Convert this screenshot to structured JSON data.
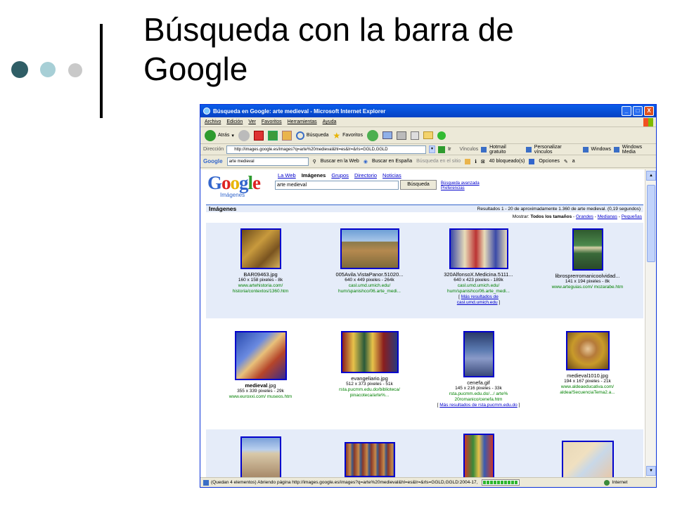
{
  "slide": {
    "title_line1": "Búsqueda con la barra de",
    "title_line2": "Google"
  },
  "colors": {
    "dot1": "#2f5e66",
    "dot2": "#a7cfd6",
    "dot3": "#c9c9c9",
    "accent": "#0000cc",
    "green": "#008000"
  },
  "window": {
    "title": "Búsqueda en Google: arte medieval - Microsoft Internet Explorer",
    "buttons": [
      "_",
      "□",
      "X"
    ]
  },
  "menu": [
    "Archivo",
    "Edición",
    "Ver",
    "Favoritos",
    "Herramientas",
    "Ayuda"
  ],
  "toolbar": {
    "back": "Atrás",
    "search": "Búsqueda",
    "favorites": "Favoritos"
  },
  "address": {
    "label": "Dirección",
    "url": "http://images.google.es/images?q=arte%20medieval&hl=es&lr=&rls=GGLD,GGLD",
    "go": "Ir",
    "links": "Vínculos",
    "hotmail": "Hotmail gratuito",
    "personalize": "Personalizar vínculos",
    "windows": "Windows",
    "windows_media": "Windows Media"
  },
  "google_toolbar": {
    "label": "Google",
    "query": "arte medieval",
    "search_web": "Buscar en la Web",
    "search_spain": "Buscar en España",
    "search_site": "Búsqueda en el sitio",
    "blocked": "40 bloqueado(s)",
    "options": "Opciones",
    "more": "a"
  },
  "google": {
    "logo": "Google",
    "logo_sub": "Imágenes",
    "nav": {
      "web": "La Web",
      "images": "Imágenes",
      "groups": "Grupos",
      "directory": "Directorio",
      "news": "Noticias"
    },
    "query": "arte medieval",
    "search_button": "Búsqueda",
    "advanced": "Búsqueda avanzada",
    "prefs": "Preferencias",
    "section": "Imágenes",
    "results_info": "Resultados 1 - 20 de aproximadamente 1.360 de arte medieval. (0,19 segundos)",
    "show": "Mostrar:",
    "all_sizes": "Todos los tamaños",
    "sep": "-",
    "large": "Grandes",
    "medium": "Medianas",
    "small": "Pequeñas"
  },
  "row1": [
    {
      "name": "BAR09463.jpg",
      "meta": "160 x 158 pixeles - 8k",
      "site1": "www.artehistoria.com/",
      "site2": "historia/contextos/1360.htm"
    },
    {
      "name": "005Avila.VistaPanor.51020...",
      "meta": "640 x 449 pixeles - 264k",
      "site1": "casl.umd.umich.edu/",
      "site2": "hum/spanishco/06.arte_medi..."
    },
    {
      "name": "320AlfonsoX.Medicina.5111...",
      "meta": "640 x 423 pixeles - 189k",
      "site1": "casl.umd.umich.edu/",
      "site2": "hum/spanishco/06.arte_medi...",
      "more1": "Más resultados de",
      "more2": "casl.umd.umich.edu"
    },
    {
      "name": "librosprerromanicoolvidad...",
      "meta": "141 x 194 pixeles - 8k",
      "site1": "www.arteguias.com/ mozarabe.htm",
      "site2": ""
    }
  ],
  "row2": [
    {
      "name": "medieval",
      "name_ext": ".jpg",
      "meta": "355 x 339 pixeles - 29k",
      "site1": "www.euroxxi.com/ museos.htm",
      "site2": ""
    },
    {
      "name": "evangeliario.jpg",
      "meta": "512 x 373 pixeles - 51k",
      "site1": "rsta.pucmm.edu.do/biblioteca/",
      "site2": "pinacoteca/arte%..."
    },
    {
      "name": "cenefa.gif",
      "meta": "145 x 216 pixeles - 33k",
      "site1": "rsta.pucmm.edu.do/.../ arte%",
      "site2": "20romanico/cenefa.htm",
      "more1": "Más resultados de rsta.pucmm.edu.do"
    },
    {
      "name": "medieval1010.jpg",
      "meta": "194 x 167 pixeles - 21k",
      "site1": "www.aldeaeducativa.com/",
      "site2": "aldea/SecuenciaTema2.a..."
    }
  ],
  "status": {
    "text": "(Quedan 4 elementos) Abriendo página http://images.google.es/images?q=arte%20medieval&hl=es&lr=&rls=GGLD,GGLD:2004-17,",
    "zone": "Internet"
  }
}
